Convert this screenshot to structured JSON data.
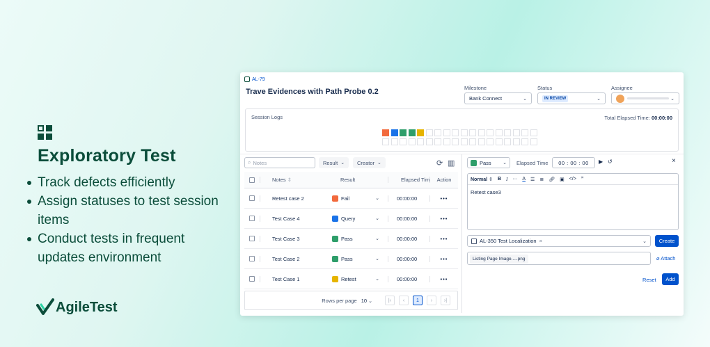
{
  "promo": {
    "heading": "Exploratory Test",
    "bullets": [
      "Track defects efficiently",
      "Assign statuses to test session items",
      "Conduct tests in frequent updates environment"
    ],
    "logo_text": "AgileTest"
  },
  "issue": {
    "key": "AL-79",
    "title": "Trave Evidences with Path Probe 0.2"
  },
  "fields": {
    "milestone_label": "Milestone",
    "milestone_value": "Bank Connect",
    "status_label": "Status",
    "status_value": "IN REVIEW",
    "assignee_label": "Assignee"
  },
  "session": {
    "title": "Session Logs",
    "total_label": "Total Elapsed Time:",
    "total_value": "00:00:00",
    "blocks": [
      "#f26a3d",
      "#1a73e8",
      "#2e9e6a",
      "#2e9e6a",
      "#e6b400"
    ]
  },
  "toolbar": {
    "notes_placeholder": "Notes",
    "result_filter": "Result",
    "creator_filter": "Creator"
  },
  "table": {
    "headers": {
      "notes": "Notes",
      "result": "Result",
      "elapsed": "Elapsed Tim",
      "action": "Action"
    },
    "rows": [
      {
        "notes": "Retest case 2",
        "result": "Fail",
        "color": "#f26a3d",
        "elapsed": "00:00:00",
        "action": "•••"
      },
      {
        "notes": "Test Case 4",
        "result": "Query",
        "color": "#1a73e8",
        "elapsed": "00:00:00",
        "action": "•••"
      },
      {
        "notes": "Test Case 3",
        "result": "Pass",
        "color": "#2e9e6a",
        "elapsed": "00:00:00",
        "action": "•••"
      },
      {
        "notes": "Test Case 2",
        "result": "Pass",
        "color": "#2e9e6a",
        "elapsed": "00:00:00",
        "action": "•••"
      },
      {
        "notes": "Test Case 1",
        "result": "Retest",
        "color": "#e6b400",
        "elapsed": "00:00:00",
        "action": "•••"
      }
    ]
  },
  "pager": {
    "rows_label": "Rows per page",
    "rows_value": "10",
    "current_page": "1"
  },
  "detail": {
    "result": "Pass",
    "result_color": "#2e9e6a",
    "elapsed_label": "Elapsed Time",
    "elapsed_value": "00 : 00 : 00",
    "format": "Normal",
    "body": "Retest case3",
    "linked_issue": "AL-350 Test Localization",
    "create_label": "Create",
    "file_name": "Listing Page Image.....png",
    "attach_label": "Attach",
    "reset_label": "Reset",
    "add_label": "Add"
  }
}
